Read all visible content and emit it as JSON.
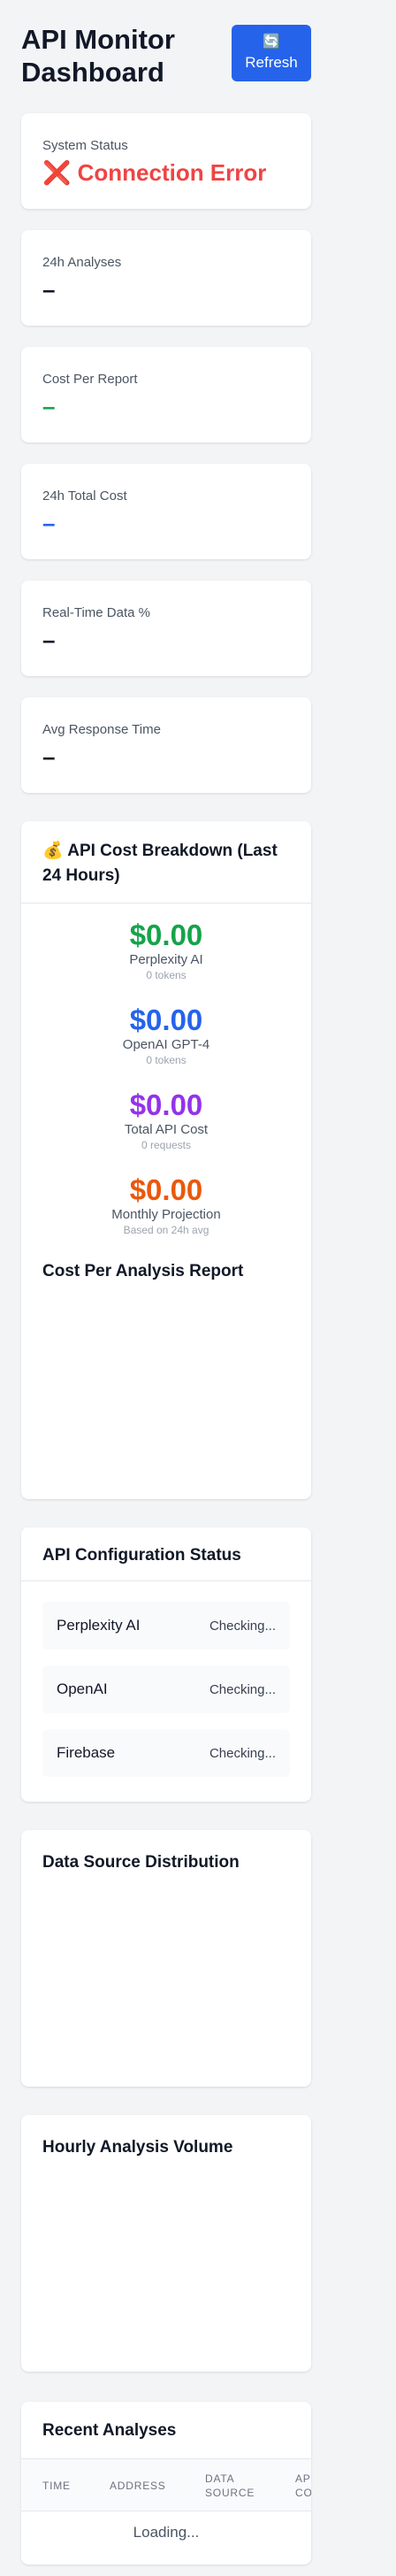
{
  "header": {
    "title": "API Monitor Dashboard",
    "refresh_icon": "🔄",
    "refresh_label": "Refresh",
    "colors": {
      "button": "#2563eb"
    }
  },
  "stats": [
    {
      "label": "System Status",
      "value": "❌ Connection Error",
      "color": "#ef4444"
    },
    {
      "label": "24h Analyses",
      "value": "–"
    },
    {
      "label": "Cost Per Report",
      "value": "–",
      "color": "#16a34a"
    },
    {
      "label": "24h Total Cost",
      "value": "–",
      "color": "#2563eb"
    },
    {
      "label": "Real-Time Data %",
      "value": "–"
    },
    {
      "label": "Avg Response Time",
      "value": "–"
    }
  ],
  "cost_breakdown": {
    "title": "💰 API Cost Breakdown (Last 24 Hours)",
    "items": [
      {
        "amount": "$0.00",
        "name": "Perplexity AI",
        "sub": "0 tokens",
        "color": "#16a34a"
      },
      {
        "amount": "$0.00",
        "name": "OpenAI GPT-4",
        "sub": "0 tokens",
        "color": "#2563eb"
      },
      {
        "amount": "$0.00",
        "name": "Total API Cost",
        "sub": "0 requests",
        "color": "#9333ea"
      },
      {
        "amount": "$0.00",
        "name": "Monthly Projection",
        "sub": "Based on 24h avg",
        "color": "#ea580c"
      }
    ],
    "report_title": "Cost Per Analysis Report"
  },
  "config": {
    "title": "API Configuration Status",
    "rows": [
      {
        "name": "Perplexity AI",
        "state": "Checking..."
      },
      {
        "name": "OpenAI",
        "state": "Checking..."
      },
      {
        "name": "Firebase",
        "state": "Checking..."
      }
    ]
  },
  "charts": {
    "data_source_title": "Data Source Distribution",
    "hourly_title": "Hourly Analysis Volume"
  },
  "recent": {
    "title": "Recent Analyses",
    "columns": [
      "Time",
      "Address",
      "Data Source",
      "API Cost"
    ],
    "loading": "Loading..."
  }
}
